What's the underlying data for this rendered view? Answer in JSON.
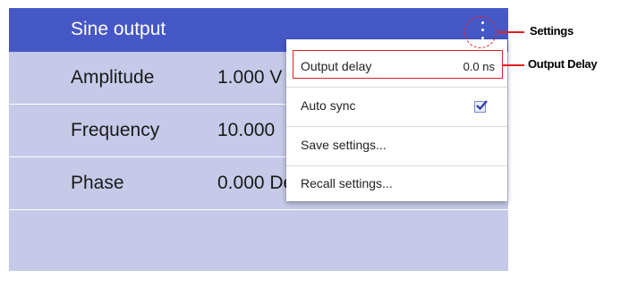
{
  "header": {
    "title": "Sine output",
    "menu_icon": "kebab-vertical-icon"
  },
  "rows": [
    {
      "label": "Amplitude",
      "value": "1.000 V"
    },
    {
      "label": "Frequency",
      "value": "10.000"
    },
    {
      "label": "Phase",
      "value": "0.000 Deg"
    }
  ],
  "menu": {
    "items": [
      {
        "label": "Output delay",
        "value": "0.0 ns"
      },
      {
        "label": "Auto sync",
        "checked": true
      },
      {
        "label": "Save settings..."
      },
      {
        "label": "Recall settings..."
      }
    ]
  },
  "callouts": {
    "settings": "Settings",
    "output_delay": "Output Delay"
  },
  "colors": {
    "header": "#4658c6",
    "panel": "#c6cae8",
    "annotation": "#e02020"
  }
}
